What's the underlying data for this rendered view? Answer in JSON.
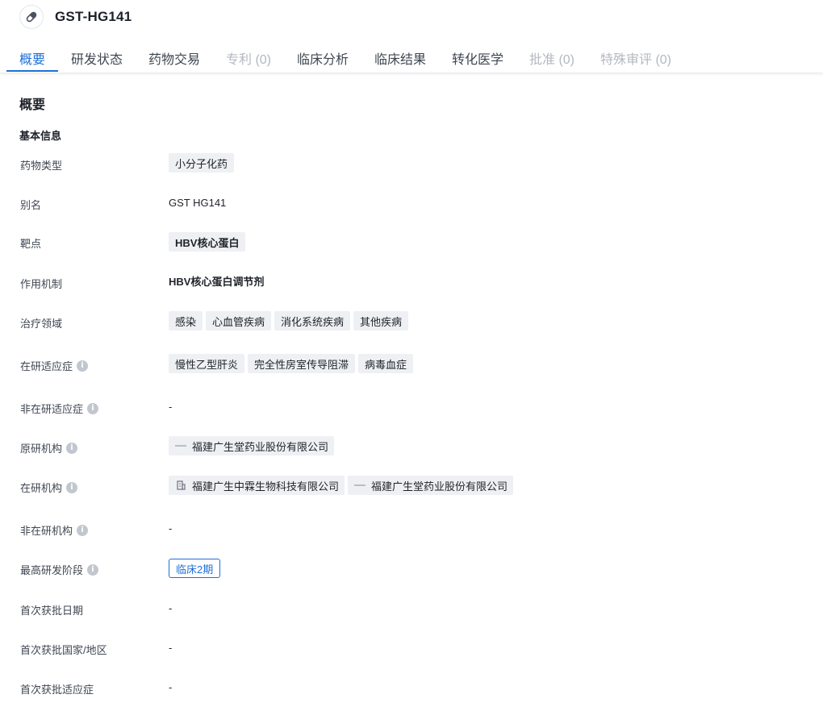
{
  "header": {
    "title": "GST-HG141",
    "icon": "pill-icon"
  },
  "tabs": [
    {
      "label": "概要",
      "active": true,
      "disabled": false
    },
    {
      "label": "研发状态",
      "active": false,
      "disabled": false
    },
    {
      "label": "药物交易",
      "active": false,
      "disabled": false
    },
    {
      "label": "专利 (0)",
      "active": false,
      "disabled": true
    },
    {
      "label": "临床分析",
      "active": false,
      "disabled": false
    },
    {
      "label": "临床结果",
      "active": false,
      "disabled": false
    },
    {
      "label": "转化医学",
      "active": false,
      "disabled": false
    },
    {
      "label": "批准 (0)",
      "active": false,
      "disabled": true
    },
    {
      "label": "特殊审评 (0)",
      "active": false,
      "disabled": true
    }
  ],
  "section": {
    "title": "概要",
    "subtitle": "基本信息"
  },
  "fields": {
    "drug_type": {
      "label": "药物类型",
      "tags": [
        "小分子化药"
      ]
    },
    "alias": {
      "label": "别名",
      "value": "GST HG141"
    },
    "target": {
      "label": "靶点",
      "tags": [
        "HBV核心蛋白"
      ]
    },
    "mechanism": {
      "label": "作用机制",
      "value": "HBV核心蛋白调节剂"
    },
    "therapeutic_area": {
      "label": "治疗领域",
      "tags": [
        "感染",
        "心血管疾病",
        "消化系统疾病",
        "其他疾病"
      ]
    },
    "active_indications": {
      "label": "在研适应症",
      "tags": [
        "慢性乙型肝炎",
        "完全性房室传导阻滞",
        "病毒血症"
      ]
    },
    "inactive_indications": {
      "label": "非在研适应症",
      "value": "-"
    },
    "originator": {
      "label": "原研机构",
      "orgs": [
        "福建广生堂药业股份有限公司"
      ]
    },
    "active_org": {
      "label": "在研机构",
      "orgs": [
        "福建广生中霖生物科技有限公司",
        "福建广生堂药业股份有限公司"
      ]
    },
    "inactive_org": {
      "label": "非在研机构",
      "value": "-"
    },
    "highest_phase": {
      "label": "最高研发阶段",
      "value": "临床2期"
    },
    "first_approval_date": {
      "label": "首次获批日期",
      "value": "-"
    },
    "first_approval_region": {
      "label": "首次获批国家/地区",
      "value": "-"
    },
    "first_approval_indication": {
      "label": "首次获批适应症",
      "value": "-"
    }
  },
  "colors": {
    "accent": "#1e6fd9",
    "tag_bg": "#eef0f3",
    "disabled_text": "#b3b8c0"
  }
}
